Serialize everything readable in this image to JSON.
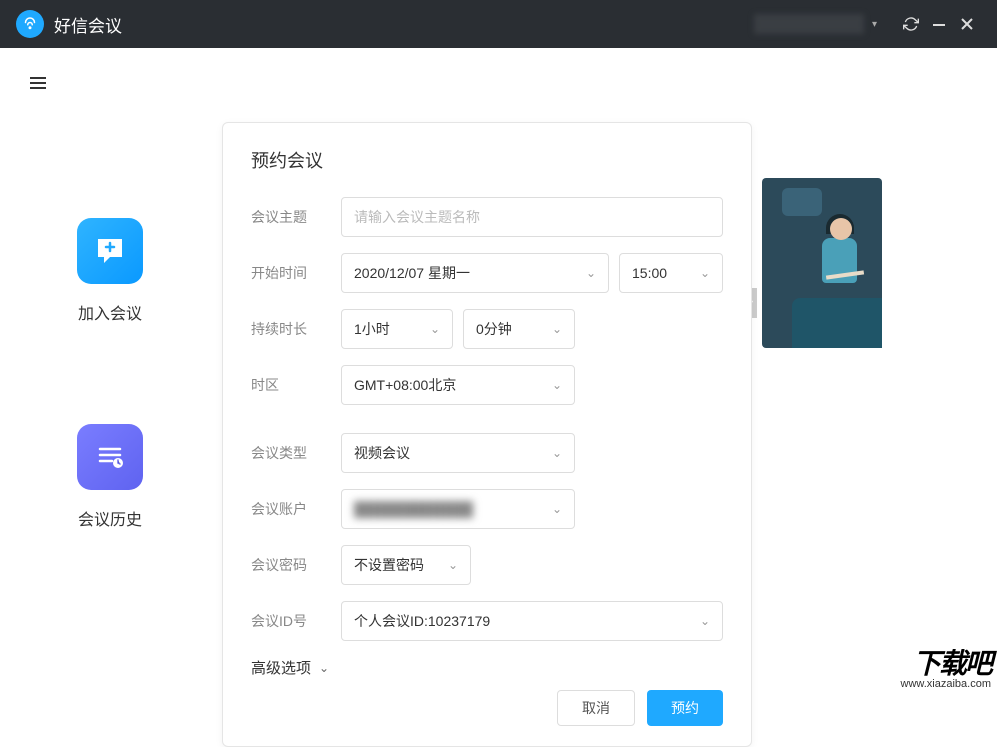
{
  "titlebar": {
    "app_name": "好信会议",
    "hidden_info": "████████"
  },
  "sidebar": {
    "join_label": "加入会议",
    "history_label": "会议历史"
  },
  "modal": {
    "title": "预约会议",
    "topic": {
      "label": "会议主题",
      "placeholder": "请输入会议主题名称"
    },
    "start_time": {
      "label": "开始时间",
      "date": "2020/12/07 星期一",
      "time": "15:00"
    },
    "duration": {
      "label": "持续时长",
      "hours": "1小时",
      "minutes": "0分钟"
    },
    "timezone": {
      "label": "时区",
      "value": "GMT+08:00北京"
    },
    "meeting_type": {
      "label": "会议类型",
      "value": "视频会议"
    },
    "account": {
      "label": "会议账户",
      "value": "████████████"
    },
    "password": {
      "label": "会议密码",
      "value": "不设置密码"
    },
    "meeting_id": {
      "label": "会议ID号",
      "value": "个人会议ID:10237179"
    },
    "advanced_label": "高级选项",
    "cancel_label": "取消",
    "confirm_label": "预约"
  },
  "watermark": {
    "main": "下载吧",
    "url": "www.xiazaiba.com"
  }
}
